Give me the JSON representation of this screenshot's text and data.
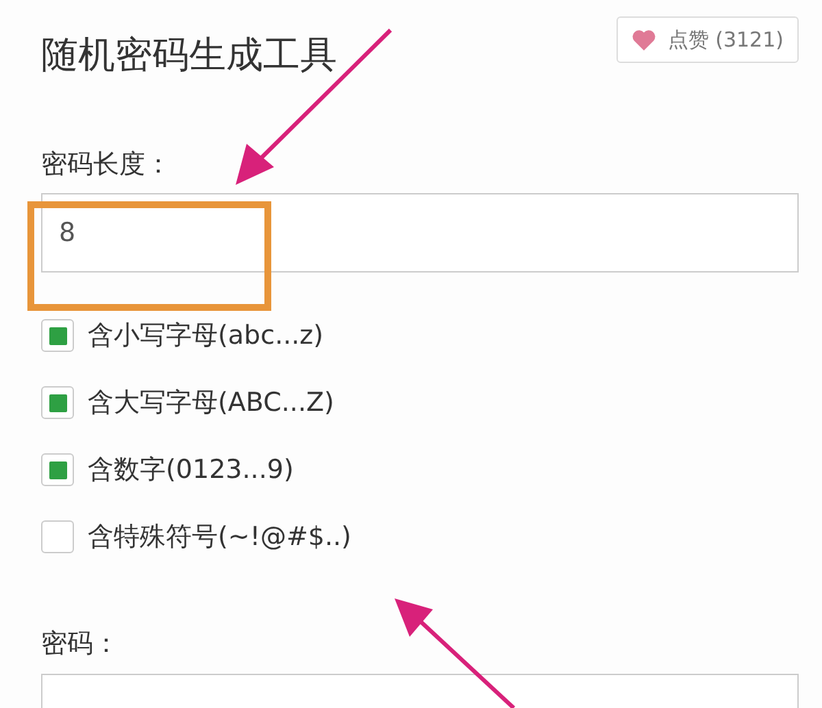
{
  "title": "随机密码生成工具",
  "like_button": {
    "label": "点赞 (3121)"
  },
  "length_field": {
    "label": "密码长度：",
    "value": "8"
  },
  "options": [
    {
      "label": "含小写字母(abc...z)",
      "checked": true
    },
    {
      "label": "含大写字母(ABC...Z)",
      "checked": true
    },
    {
      "label": "含数字(0123...9)",
      "checked": true
    },
    {
      "label": "含特殊符号(~!@#$..)",
      "checked": false
    }
  ],
  "password_field": {
    "label": "密码："
  }
}
